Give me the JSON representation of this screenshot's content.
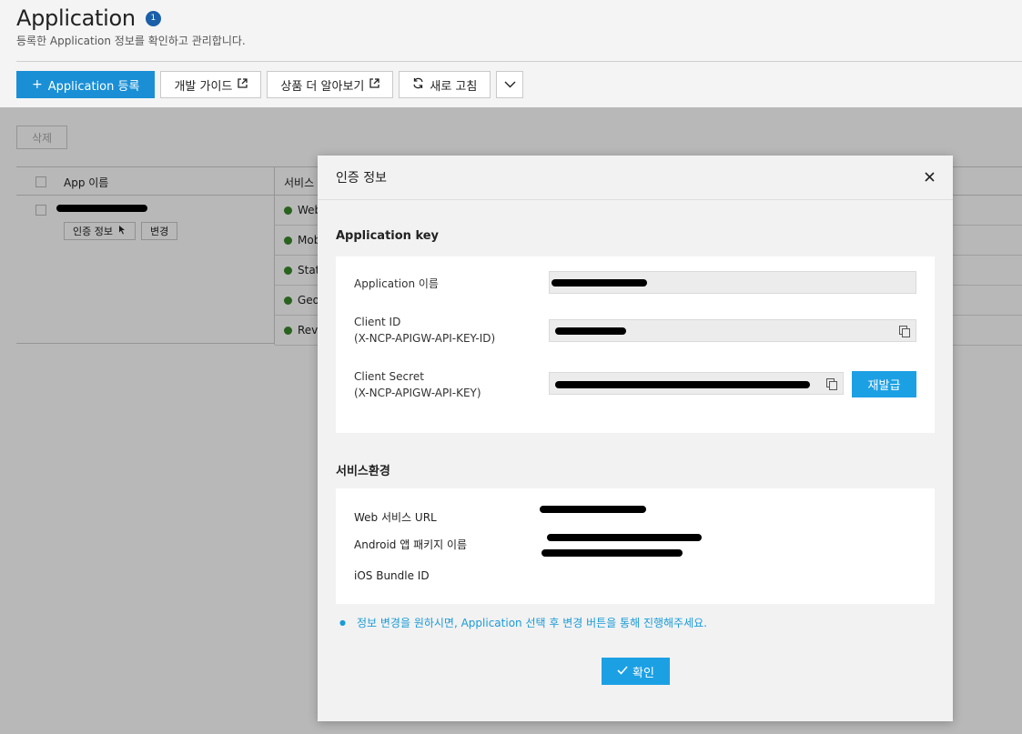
{
  "page": {
    "title": "Application",
    "badge": "1",
    "subtitle": "등록한 Application 정보를 확인하고 관리합니다."
  },
  "toolbar": {
    "register_label": "Application 등록",
    "guide_label": "개발 가이드",
    "product_label": "상품 더 알아보기",
    "refresh_label": "새로 고침"
  },
  "list": {
    "delete_label": "삭제",
    "columns": [
      "App 이름",
      "서비스"
    ],
    "row_actions": [
      "인증 정보",
      "변경"
    ],
    "services": [
      "Web",
      "Mob",
      "Stat",
      "Geo",
      "Reve"
    ]
  },
  "modal": {
    "title": "인증 정보",
    "key_section": "Application key",
    "fields": {
      "app_name_label": "Application 이름",
      "client_id_label_1": "Client ID",
      "client_id_label_2": "(X-NCP-APIGW-API-KEY-ID)",
      "client_secret_label_1": "Client Secret",
      "client_secret_label_2": "(X-NCP-APIGW-API-KEY)"
    },
    "reissue_label": "재발급",
    "service_section": "서비스환경",
    "service_fields": {
      "web_label": "Web 서비스 URL",
      "android_label": "Android 앱 패키지 이름",
      "ios_label": "iOS Bundle ID"
    },
    "notice": "정보 변경을 원하시면, Application 선택 후 변경 버튼을 통해 진행해주세요.",
    "confirm_label": "확인"
  },
  "colors": {
    "primary": "#1a8fd6",
    "accent": "#1ca0e4",
    "notice": "#1a9bd8"
  }
}
